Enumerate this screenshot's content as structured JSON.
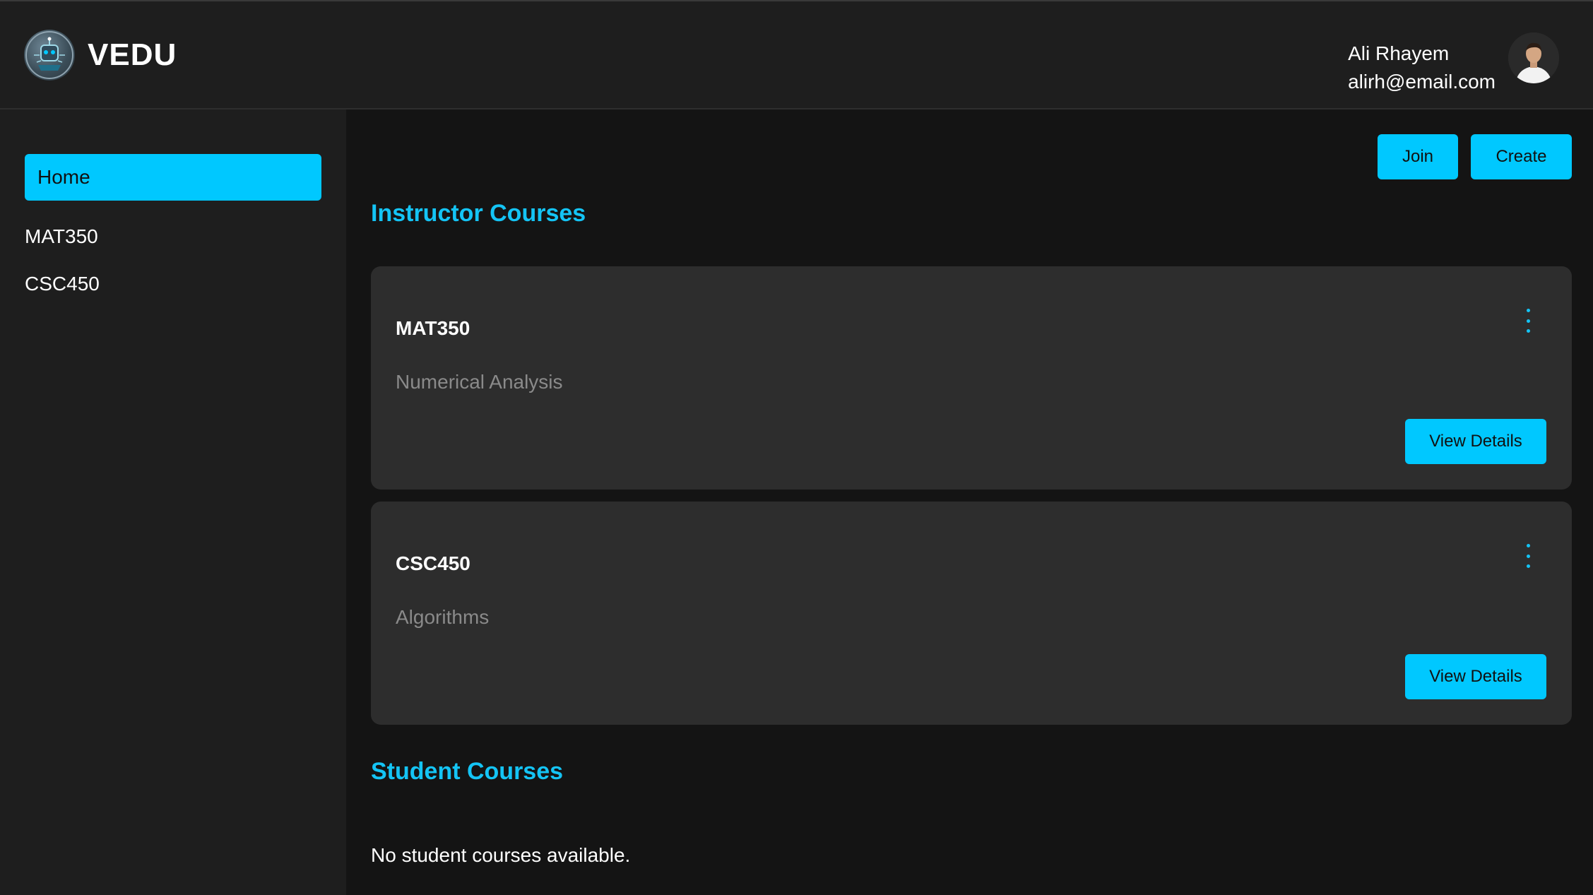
{
  "header": {
    "app_name": "VEDU",
    "logo_icon": "robot-brain-logo-icon",
    "user": {
      "name": "Ali Rhayem",
      "email": "alirh@email.com"
    }
  },
  "sidebar": {
    "items": [
      {
        "label": "Home",
        "active": true
      },
      {
        "label": "MAT350",
        "active": false
      },
      {
        "label": "CSC450",
        "active": false
      }
    ]
  },
  "actions": {
    "join_label": "Join",
    "create_label": "Create"
  },
  "instructor_courses": {
    "title": "Instructor Courses",
    "courses": [
      {
        "code": "MAT350",
        "name": "Numerical Analysis",
        "button_label": "View Details"
      },
      {
        "code": "CSC450",
        "name": "Algorithms",
        "button_label": "View Details"
      }
    ]
  },
  "student_courses": {
    "title": "Student Courses",
    "empty_message": "No student courses available."
  },
  "colors": {
    "accent": "#00c8ff",
    "title_accent": "#14c4f5",
    "header_bg": "#1e1e1e",
    "page_bg": "#141414",
    "card_bg": "#2d2d2d"
  }
}
